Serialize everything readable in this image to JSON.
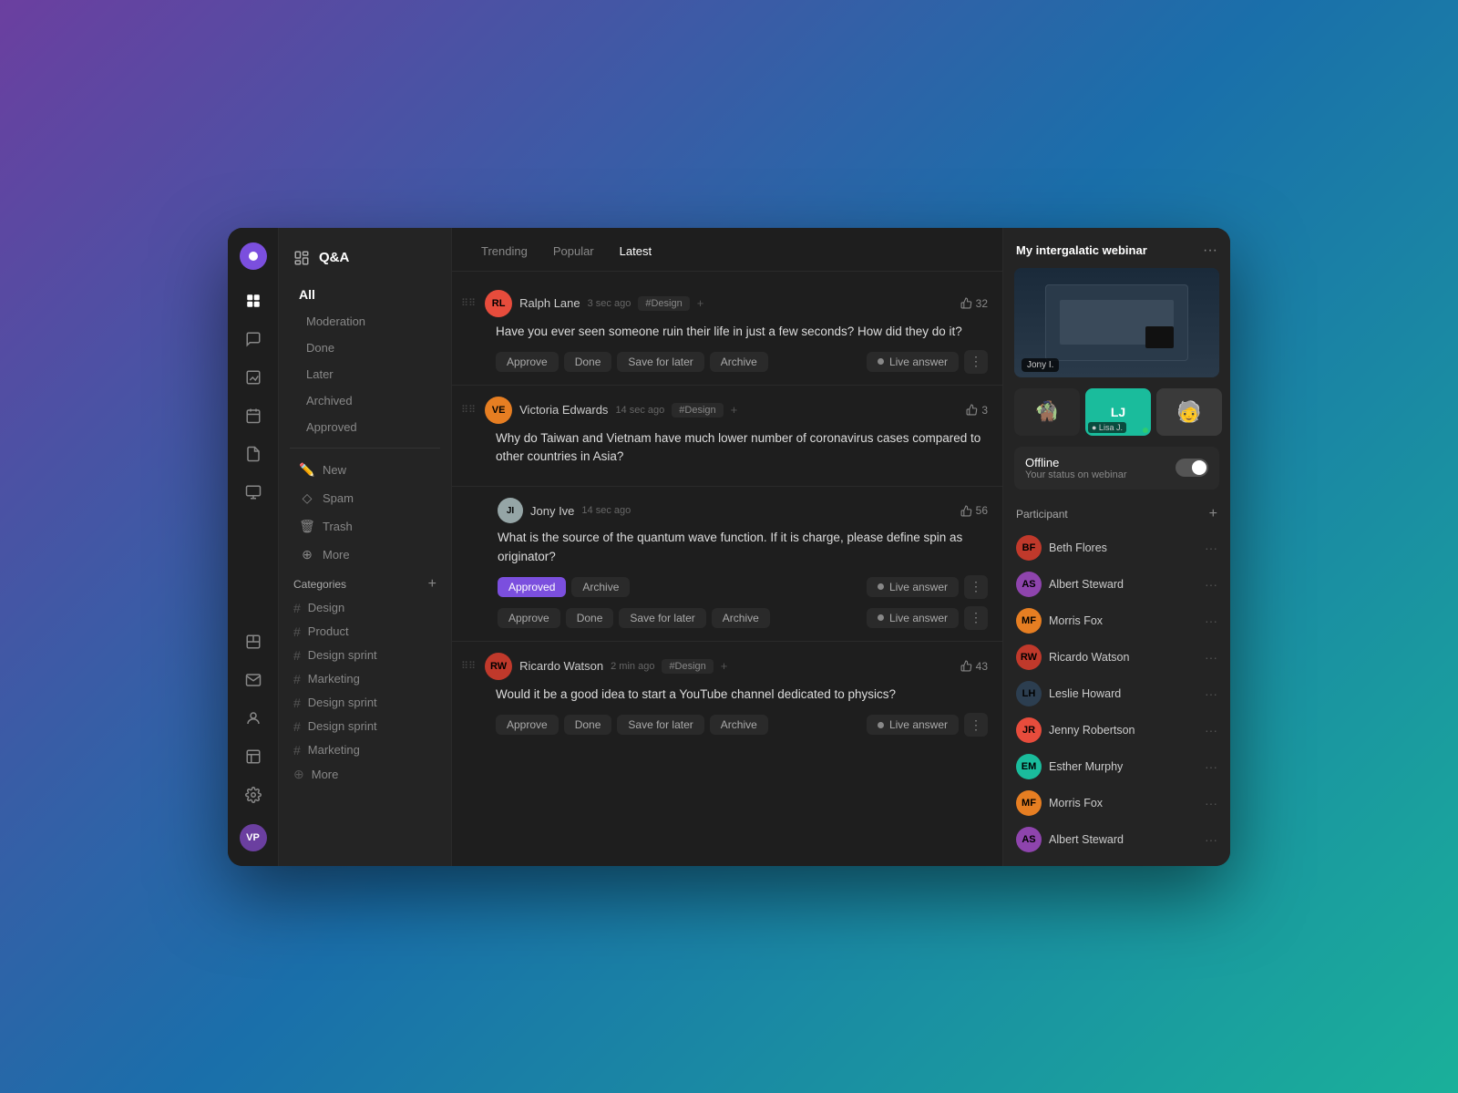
{
  "app": {
    "title": "Q&A"
  },
  "sidebar": {
    "title": "Q&A",
    "sections": {
      "all_label": "All",
      "items": [
        {
          "id": "moderation",
          "label": "Moderation"
        },
        {
          "id": "done",
          "label": "Done"
        },
        {
          "id": "later",
          "label": "Later"
        },
        {
          "id": "archived",
          "label": "Archived"
        },
        {
          "id": "approved",
          "label": "Approved"
        }
      ]
    },
    "action_items": [
      {
        "id": "new",
        "label": "New",
        "icon": "✏️"
      },
      {
        "id": "spam",
        "label": "Spam",
        "icon": "◇"
      },
      {
        "id": "trash",
        "label": "Trash",
        "icon": "🗑"
      },
      {
        "id": "more",
        "label": "More",
        "icon": "⊕"
      }
    ],
    "categories_label": "Categories",
    "categories": [
      {
        "id": "design",
        "label": "Design"
      },
      {
        "id": "product",
        "label": "Product"
      },
      {
        "id": "design-sprint-1",
        "label": "Design sprint"
      },
      {
        "id": "marketing-1",
        "label": "Marketing"
      },
      {
        "id": "design-sprint-2",
        "label": "Design sprint"
      },
      {
        "id": "design-sprint-3",
        "label": "Design sprint"
      },
      {
        "id": "marketing-2",
        "label": "Marketing"
      },
      {
        "id": "more-cat",
        "label": "More"
      }
    ]
  },
  "tabs": [
    {
      "id": "trending",
      "label": "Trending"
    },
    {
      "id": "popular",
      "label": "Popular"
    },
    {
      "id": "latest",
      "label": "Latest",
      "active": true
    }
  ],
  "questions": [
    {
      "id": "q1",
      "author": "Ralph Lane",
      "initials": "RL",
      "avatar_color": "#E74C3C",
      "time": "3 sec ago",
      "tag": "#Design",
      "likes": 32,
      "body": "Have you ever seen someone ruin their life in just a few seconds? How did they do it?",
      "actions": [
        "Approve",
        "Done",
        "Save for later",
        "Archive"
      ],
      "status": "normal"
    },
    {
      "id": "q2",
      "author": "Victoria Edwards",
      "initials": "VE",
      "avatar_color": "#E67E22",
      "time": "14 sec ago",
      "tag": "#Design",
      "likes": 3,
      "body": "Why do Taiwan and Vietnam have much lower number of coronavirus cases compared to other countries in Asia?",
      "actions": [],
      "status": "normal"
    },
    {
      "id": "q3",
      "author": "Jony Ive",
      "initials": "JI",
      "avatar_color": "#7F8C8D",
      "time": "14 sec ago",
      "tag": "",
      "likes": 56,
      "body": "What is the source of the quantum wave function. If it is charge, please define spin as originator?",
      "actions": [
        "Archive"
      ],
      "status": "approved"
    },
    {
      "id": "q4",
      "author": "Jony Ive",
      "initials": "JI",
      "avatar_color": "#7F8C8D",
      "time": "14 sec ago",
      "tag": "",
      "likes": 56,
      "body": "",
      "actions": [
        "Approve",
        "Done",
        "Save for later",
        "Archive"
      ],
      "status": "normal",
      "is_reply": true
    },
    {
      "id": "q5",
      "author": "Ricardo Watson",
      "initials": "RW",
      "avatar_color": "#E74C3C",
      "time": "2 min ago",
      "tag": "#Design",
      "likes": 43,
      "body": "Would it be a good idea to start a YouTube channel dedicated to physics?",
      "actions": [
        "Approve",
        "Done",
        "Save for later",
        "Archive"
      ],
      "status": "normal"
    }
  ],
  "right_panel": {
    "title": "My intergalatic webinar",
    "webinar_label": "Jony I.",
    "thumbnails": [
      {
        "id": "t1",
        "emoji": "🧌",
        "label": "",
        "has_dot": false
      },
      {
        "id": "t2",
        "initials": "LJ",
        "label": "● Lisa J.",
        "bg": "#1ABC9C",
        "has_dot": true
      },
      {
        "id": "t3",
        "emoji": "🧓",
        "label": "",
        "has_dot": false
      }
    ],
    "offline_status": "Offline",
    "offline_sub": "Your status on webinar",
    "participant_label": "Participant",
    "participants": [
      {
        "id": "p1",
        "name": "Beth Flores",
        "initials": "BF",
        "color": "#C0392B"
      },
      {
        "id": "p2",
        "name": "Albert Steward",
        "initials": "AS",
        "color": "#8E44AD"
      },
      {
        "id": "p3",
        "name": "Morris Fox",
        "initials": "MF",
        "color": "#E67E22"
      },
      {
        "id": "p4",
        "name": "Ricardo Watson",
        "initials": "RW",
        "color": "#C0392B"
      },
      {
        "id": "p5",
        "name": "Leslie Howard",
        "initials": "LH",
        "color": "#2C3E50"
      },
      {
        "id": "p6",
        "name": "Jenny Robertson",
        "initials": "JR",
        "color": "#E74C3C"
      },
      {
        "id": "p7",
        "name": "Esther Murphy",
        "initials": "EM",
        "color": "#1ABC9C"
      },
      {
        "id": "p8",
        "name": "Morris Fox",
        "initials": "MF",
        "color": "#E67E22"
      },
      {
        "id": "p9",
        "name": "Albert Steward",
        "initials": "AS",
        "color": "#8E44AD"
      }
    ]
  },
  "icons": {
    "drag_handle": "⠿",
    "like_thumb": "👍",
    "live_dot": "●",
    "hash": "#"
  },
  "user": {
    "initials": "VP",
    "avatar_color": "#8E44AD"
  }
}
